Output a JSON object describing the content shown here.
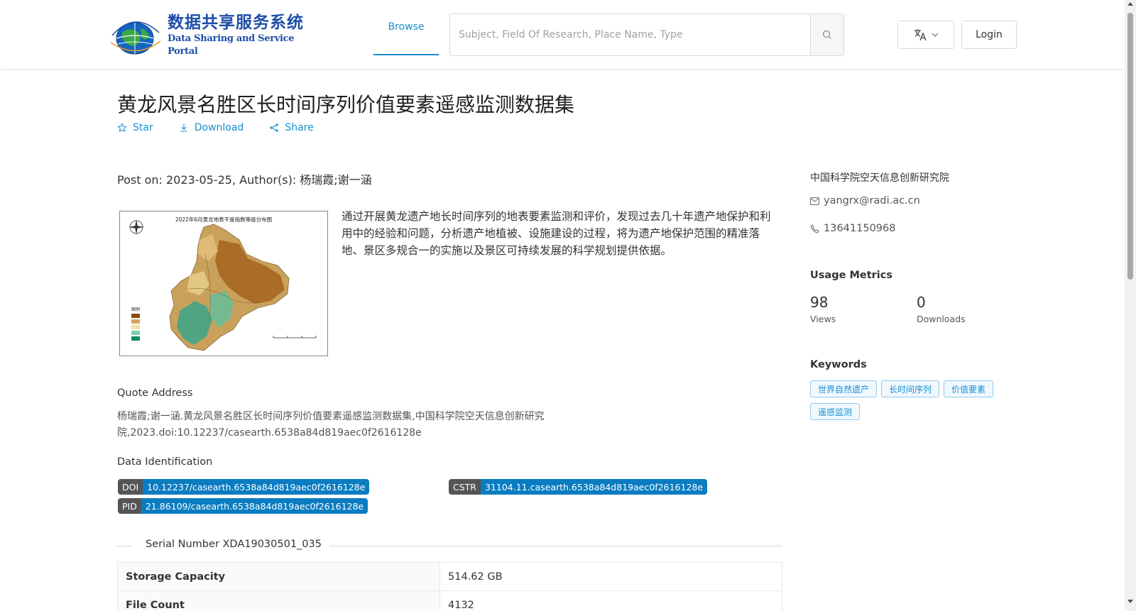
{
  "header": {
    "logo_cn": "数据共享服务系统",
    "logo_en": "Data Sharing and Service Portal",
    "nav_browse": "Browse",
    "search_placeholder": "Subject, Field Of Research, Place Name, Type",
    "login_label": "Login",
    "lang_icon": "translate-icon"
  },
  "dataset": {
    "title": "黄龙风景名胜区长时间序列价值要素遥感监测数据集",
    "actions": {
      "star": "Star",
      "download": "Download",
      "share": "Share"
    },
    "post_line": "Post on: 2023-05-25, Author(s): 杨瑞霞;谢一涵",
    "thumb_title": "2022年6月黄龙地表干度指数等级分布图",
    "thumb_legend_title": "图例",
    "abstract": "通过开展黄龙遗产地长时间序列的地表要素监测和评价，发现过去几十年遗产地保护和利用中的经验和问题，分析遗产地植被、设施建设的过程，将为遗产地保护范围的精准落地、景区多规合一的实施以及景区可持续发展的科学规划提供依据。",
    "quote_label": "Quote Address",
    "quote_text": "杨瑞霞;谢一涵.黄龙风景名胜区长时间序列价值要素遥感监测数据集,中国科学院空天信息创新研究院,2023.doi:10.12237/casearth.6538a84d819aec0f2616128e",
    "identification_label": "Data Identification",
    "ids": {
      "doi_key": "DOI",
      "doi_val": "10.12237/casearth.6538a84d819aec0f2616128e",
      "cstr_key": "CSTR",
      "cstr_val": "31104.11.casearth.6538a84d819aec0f2616128e",
      "pid_key": "PID",
      "pid_val": "21.86109/casearth.6538a84d819aec0f2616128e"
    },
    "serial": "Serial Number XDA19030501_035",
    "table": [
      {
        "label": "Storage Capacity",
        "value": "514.62 GB"
      },
      {
        "label": "File Count",
        "value": "4132"
      }
    ]
  },
  "sidebar": {
    "org": "中国科学院空天信息创新研究院",
    "email": "yangrx@radi.ac.cn",
    "phone": "13641150968",
    "usage_heading": "Usage Metrics",
    "views_value": "98",
    "views_label": "Views",
    "downloads_value": "0",
    "downloads_label": "Downloads",
    "keywords_heading": "Keywords",
    "keywords": [
      "世界自然遗产",
      "长时间序列",
      "价值要素",
      "遥感监测"
    ]
  },
  "colors": {
    "accent": "#1a8fd1",
    "badge_key": "#555555",
    "badge_value": "#0a7cc1"
  }
}
